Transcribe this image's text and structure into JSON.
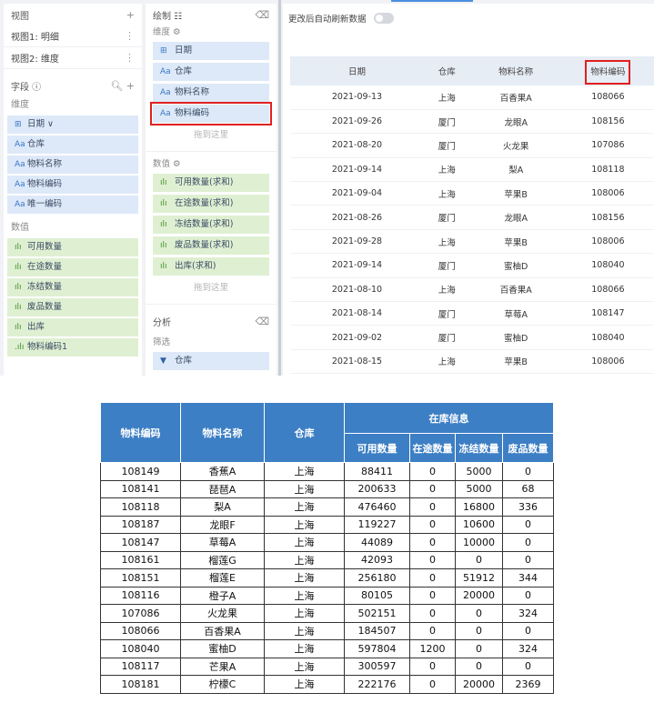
{
  "left_panel": {
    "header": "视图",
    "add_icon": "+",
    "views": [
      "视图1: 明细",
      "视图2: 维度"
    ],
    "fields_title": "字段 ⓘ",
    "dimension_title": "维度",
    "dimensions": [
      {
        "tag": "⊞",
        "label": "日期 ∨"
      },
      {
        "tag": "Aa",
        "label": "仓库"
      },
      {
        "tag": "Aa",
        "label": "物料名称"
      },
      {
        "tag": "Aa",
        "label": "物料编码"
      },
      {
        "tag": "Aa",
        "label": "唯一编码"
      }
    ],
    "measure_title": "数值",
    "measures": [
      {
        "tag": "ılı",
        "label": "可用数量"
      },
      {
        "tag": "ılı",
        "label": "在途数量"
      },
      {
        "tag": "ılı",
        "label": "冻结数量"
      },
      {
        "tag": "ılı",
        "label": "废品数量"
      },
      {
        "tag": "ılı",
        "label": "出库"
      },
      {
        "tag": ".ılı",
        "label": "物料编码1"
      }
    ]
  },
  "middle_panel": {
    "header": "绘制 ☷",
    "dimension_title": "维度 ⚙",
    "dimensions": [
      {
        "tag": "⊞",
        "label": "日期"
      },
      {
        "tag": "Aa",
        "label": "仓库"
      },
      {
        "tag": "Aa",
        "label": "物料名称"
      },
      {
        "tag": "Aa",
        "label": "物料编码"
      }
    ],
    "drop_hint": "拖到这里",
    "measure_title": "数值 ⚙",
    "measures": [
      {
        "tag": "ılı",
        "label": "可用数量(求和)"
      },
      {
        "tag": "ılı",
        "label": "在途数量(求和)"
      },
      {
        "tag": "ılı",
        "label": "冻结数量(求和)"
      },
      {
        "tag": "ılı",
        "label": "废品数量(求和)"
      },
      {
        "tag": "ılı",
        "label": "出库(求和)"
      }
    ],
    "analysis_title": "分析",
    "filter_title": "筛选",
    "filter_chip": {
      "tag": "▼",
      "label": "仓库"
    }
  },
  "preview": {
    "auto_refresh_label": "更改后自动刷新数据",
    "columns": [
      "日期",
      "仓库",
      "物料名称",
      "物料编码"
    ],
    "rows": [
      [
        "2021-09-13",
        "上海",
        "百香果A",
        "108066"
      ],
      [
        "2021-09-26",
        "厦门",
        "龙眼A",
        "108156"
      ],
      [
        "2021-08-20",
        "厦门",
        "火龙果",
        "107086"
      ],
      [
        "2021-09-14",
        "上海",
        "梨A",
        "108118"
      ],
      [
        "2021-09-04",
        "上海",
        "苹果B",
        "108006"
      ],
      [
        "2021-08-26",
        "厦门",
        "龙眼A",
        "108156"
      ],
      [
        "2021-09-28",
        "上海",
        "苹果B",
        "108006"
      ],
      [
        "2021-09-14",
        "厦门",
        "蜜柚D",
        "108040"
      ],
      [
        "2021-08-10",
        "上海",
        "百香果A",
        "108066"
      ],
      [
        "2021-08-14",
        "厦门",
        "草莓A",
        "108147"
      ],
      [
        "2021-09-02",
        "厦门",
        "蜜柚D",
        "108040"
      ],
      [
        "2021-08-15",
        "上海",
        "苹果B",
        "108006"
      ]
    ]
  },
  "report": {
    "headers": {
      "code": "物料编码",
      "name": "物料名称",
      "warehouse": "仓库",
      "group": "在库信息"
    },
    "sub_headers": [
      "可用数量",
      "在途数量",
      "冻结数量",
      "废品数量"
    ],
    "rows": [
      [
        "108149",
        "香蕉A",
        "上海",
        "88411",
        "0",
        "5000",
        "0"
      ],
      [
        "108141",
        "琵琶A",
        "上海",
        "200633",
        "0",
        "5000",
        "68"
      ],
      [
        "108118",
        "梨A",
        "上海",
        "476460",
        "0",
        "16800",
        "336"
      ],
      [
        "108187",
        "龙眼F",
        "上海",
        "119227",
        "0",
        "10600",
        "0"
      ],
      [
        "108147",
        "草莓A",
        "上海",
        "44089",
        "0",
        "10000",
        "0"
      ],
      [
        "108161",
        "榴莲G",
        "上海",
        "42093",
        "0",
        "0",
        "0"
      ],
      [
        "108151",
        "榴莲E",
        "上海",
        "256180",
        "0",
        "51912",
        "344"
      ],
      [
        "108116",
        "橙子A",
        "上海",
        "80105",
        "0",
        "20000",
        "0"
      ],
      [
        "107086",
        "火龙果",
        "上海",
        "502151",
        "0",
        "0",
        "324"
      ],
      [
        "108066",
        "百香果A",
        "上海",
        "184507",
        "0",
        "0",
        "0"
      ],
      [
        "108040",
        "蜜柚D",
        "上海",
        "597804",
        "1200",
        "0",
        "324"
      ],
      [
        "108117",
        "芒果A",
        "上海",
        "300597",
        "0",
        "0",
        "0"
      ],
      [
        "108181",
        "柠檬C",
        "上海",
        "222176",
        "0",
        "20000",
        "2369"
      ]
    ]
  },
  "colors": {
    "accent": "#3d7fc4",
    "highlight": "#e02020",
    "dimension": "#dde9f8",
    "measure": "#dff0d2"
  }
}
